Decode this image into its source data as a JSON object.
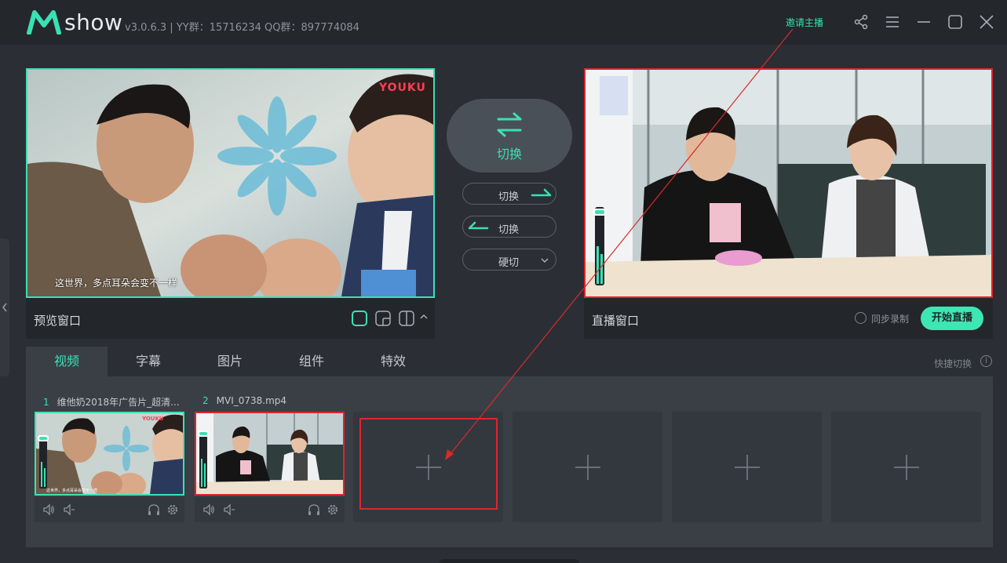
{
  "app": {
    "logo_text": "show",
    "version_info": "v3.0.6.3 | YY群：15716234 QQ群：897774084",
    "invite_label": "邀请主播",
    "accent_color": "#3be0b5",
    "live_color": "#e0242c"
  },
  "titlebar_icons": [
    "share-icon",
    "menu-icon",
    "minimize-icon",
    "maximize-icon",
    "close-icon"
  ],
  "preview": {
    "title": "预览窗口",
    "caption": "这世界，多点耳朵会变不一样",
    "watermark": "YOUKU"
  },
  "live": {
    "title": "直播窗口",
    "sync_record_label": "同步录制",
    "start_button": "开始直播"
  },
  "switch": {
    "main_label": "切换",
    "right_label": "切换",
    "left_label": "切换",
    "hard_cut_label": "硬切"
  },
  "tabs": [
    {
      "label": "视频",
      "active": true
    },
    {
      "label": "字幕",
      "active": false
    },
    {
      "label": "图片",
      "active": false
    },
    {
      "label": "组件",
      "active": false
    },
    {
      "label": "特效",
      "active": false
    }
  ],
  "quick_switch_label": "快捷切换",
  "sources": [
    {
      "num": "1",
      "name": "维他奶2018年广告片_超清..."
    },
    {
      "num": "2",
      "name": "MVI_0738.mp4"
    }
  ],
  "empty_slots": 4
}
